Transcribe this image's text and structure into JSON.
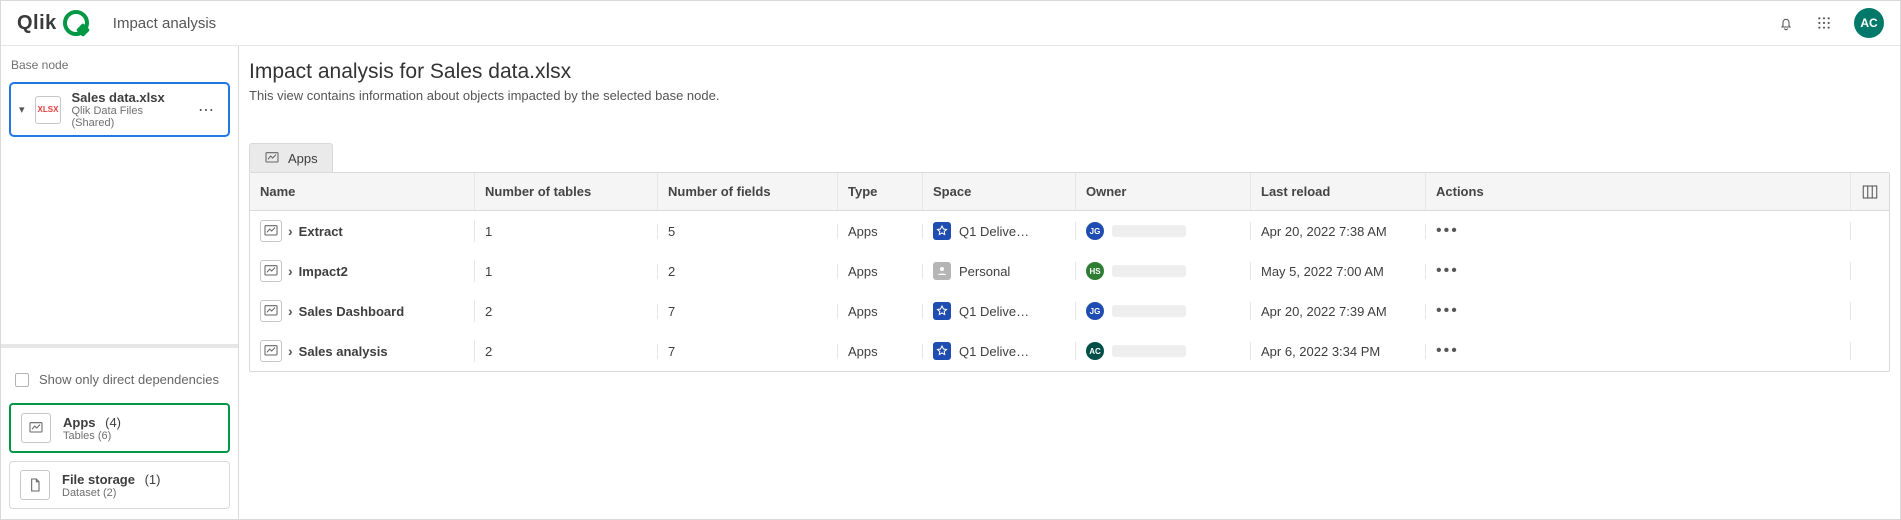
{
  "topbar": {
    "logo_text": "Qlik",
    "page_title": "Impact analysis",
    "user_initials": "AC"
  },
  "sidebar": {
    "base_node_label": "Base node",
    "base_node": {
      "name": "Sales data.xlsx",
      "sub": "Qlik Data Files (Shared)",
      "file_badge": "XLSX"
    },
    "show_direct_label": "Show only direct dependencies",
    "apps_card": {
      "title": "Apps",
      "count": "(4)",
      "sub": "Tables (6)"
    },
    "storage_card": {
      "title": "File storage",
      "count": "(1)",
      "sub": "Dataset (2)"
    }
  },
  "main": {
    "heading": "Impact analysis for Sales data.xlsx",
    "description": "This view contains information about objects impacted by the selected base node.",
    "tab_label": "Apps",
    "columns": {
      "name": "Name",
      "tables": "Number of tables",
      "fields": "Number of fields",
      "type": "Type",
      "space": "Space",
      "owner": "Owner",
      "reload": "Last reload",
      "actions": "Actions"
    },
    "rows": [
      {
        "name": "Extract",
        "tables": "1",
        "fields": "5",
        "type": "Apps",
        "space": "Q1 Delive…",
        "space_kind": "shared",
        "owner_initials": "JG",
        "owner_color": "#1f4db1",
        "reload": "Apr 20, 2022 7:38 AM"
      },
      {
        "name": "Impact2",
        "tables": "1",
        "fields": "2",
        "type": "Apps",
        "space": "Personal",
        "space_kind": "personal",
        "owner_initials": "HS",
        "owner_color": "#2e7d32",
        "reload": "May 5, 2022 7:00 AM"
      },
      {
        "name": "Sales Dashboard",
        "tables": "2",
        "fields": "7",
        "type": "Apps",
        "space": "Q1 Delive…",
        "space_kind": "shared",
        "owner_initials": "JG",
        "owner_color": "#1f4db1",
        "reload": "Apr 20, 2022 7:39 AM"
      },
      {
        "name": "Sales analysis",
        "tables": "2",
        "fields": "7",
        "type": "Apps",
        "space": "Q1 Delive…",
        "space_kind": "shared",
        "owner_initials": "AC",
        "owner_color": "#00504a",
        "reload": "Apr 6, 2022 3:34 PM"
      }
    ]
  }
}
